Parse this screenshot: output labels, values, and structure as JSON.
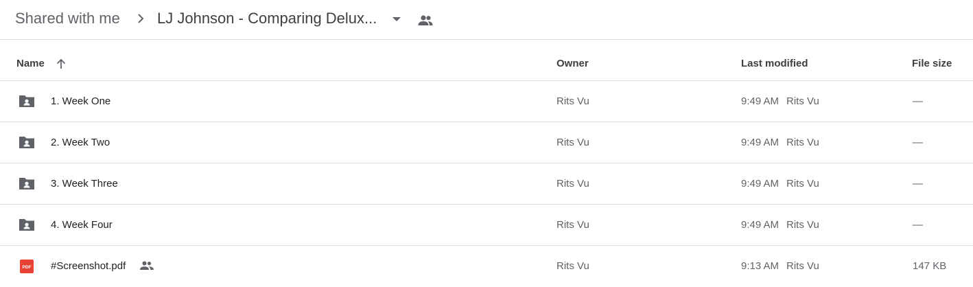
{
  "breadcrumb": {
    "root": "Shared with me",
    "current": "LJ Johnson - Comparing Delux..."
  },
  "columns": {
    "name": "Name",
    "owner": "Owner",
    "last_modified": "Last modified",
    "file_size": "File size"
  },
  "files": [
    {
      "name": "1. Week One",
      "type": "shared-folder",
      "owner": "Rits Vu",
      "modified_time": "9:49 AM",
      "modified_by": "Rits Vu",
      "size": "—"
    },
    {
      "name": "2. Week Two",
      "type": "shared-folder",
      "owner": "Rits Vu",
      "modified_time": "9:49 AM",
      "modified_by": "Rits Vu",
      "size": "—"
    },
    {
      "name": "3. Week Three",
      "type": "shared-folder",
      "owner": "Rits Vu",
      "modified_time": "9:49 AM",
      "modified_by": "Rits Vu",
      "size": "—"
    },
    {
      "name": "4. Week Four",
      "type": "shared-folder",
      "owner": "Rits Vu",
      "modified_time": "9:49 AM",
      "modified_by": "Rits Vu",
      "size": "—"
    },
    {
      "name": "#Screenshot.pdf",
      "type": "pdf",
      "icon_label": "PDF",
      "shared": true,
      "owner": "Rits Vu",
      "modified_time": "9:13 AM",
      "modified_by": "Rits Vu",
      "size": "147 KB"
    }
  ],
  "colors": {
    "folder_icon": "#5f6368",
    "pdf_icon": "#ea4335",
    "divider": "#dadce0"
  }
}
